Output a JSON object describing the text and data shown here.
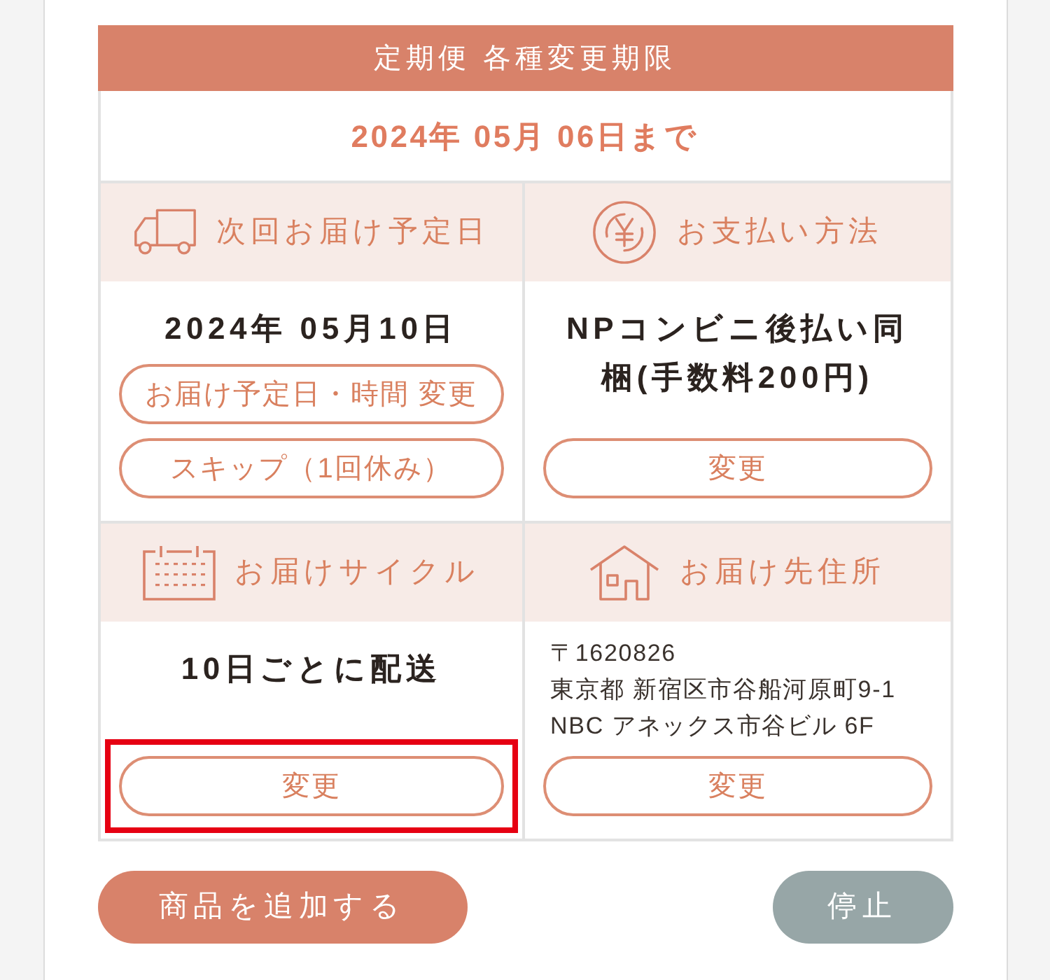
{
  "deadline": {
    "title": "定期便 各種変更期限",
    "date": "2024年 05月 06日まで"
  },
  "sections": [
    {
      "kind": "date",
      "title": "次回お届け予定日",
      "value": "2024年 05月10日",
      "buttons": [
        {
          "label": "お届け予定日・時間 変更",
          "highlighted": false
        },
        {
          "label": "スキップ（1回休み）",
          "highlighted": false
        }
      ]
    },
    {
      "kind": "payment",
      "title": "お支払い方法",
      "value": "NPコンビニ後払い同梱(手数料200円)",
      "buttons": [
        {
          "label": "変更",
          "highlighted": false
        }
      ]
    },
    {
      "kind": "cycle",
      "title": "お届けサイクル",
      "value": "10日ごとに配送",
      "buttons": [
        {
          "label": "変更",
          "highlighted": true
        }
      ]
    },
    {
      "kind": "address",
      "title": "お届け先住所",
      "lines": [
        "〒1620826",
        "東京都 新宿区市谷船河原町9-1",
        "NBC アネックス市谷ビル 6F"
      ],
      "buttons": [
        {
          "label": "変更",
          "highlighted": false
        }
      ]
    }
  ],
  "actions": [
    {
      "label": "商品を追加する",
      "kind": "primary"
    },
    {
      "label": "停止",
      "kind": "secondary"
    }
  ]
}
